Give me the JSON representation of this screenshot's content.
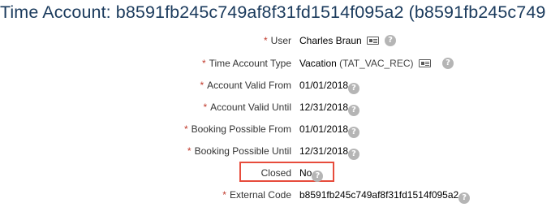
{
  "title": "Time Account: b8591fb245c749af8f31fd1514f095a2 (b8591fb245c749",
  "required_marker": "*",
  "help_glyph": "?",
  "icons": {
    "card": "id-card-icon",
    "help": "help-circle-icon"
  },
  "colors": {
    "title": "#1a3a5c",
    "required": "#c0392b",
    "highlight": "#e74c3c",
    "help_bg": "#b5b5b5"
  },
  "fields": {
    "user": {
      "label": "User",
      "value": "Charles Braun"
    },
    "time_account_type": {
      "label": "Time Account Type",
      "value": "Vacation",
      "code": "(TAT_VAC_REC)"
    },
    "account_valid_from": {
      "label": "Account Valid From",
      "value": "01/01/2018"
    },
    "account_valid_until": {
      "label": "Account Valid Until",
      "value": "12/31/2018"
    },
    "booking_possible_from": {
      "label": "Booking Possible From",
      "value": "01/01/2018"
    },
    "booking_possible_until": {
      "label": "Booking Possible Until",
      "value": "12/31/2018"
    },
    "closed": {
      "label": "Closed",
      "value": "No"
    },
    "external_code": {
      "label": "External Code",
      "value": "b8591fb245c749af8f31fd1514f095a2"
    }
  }
}
